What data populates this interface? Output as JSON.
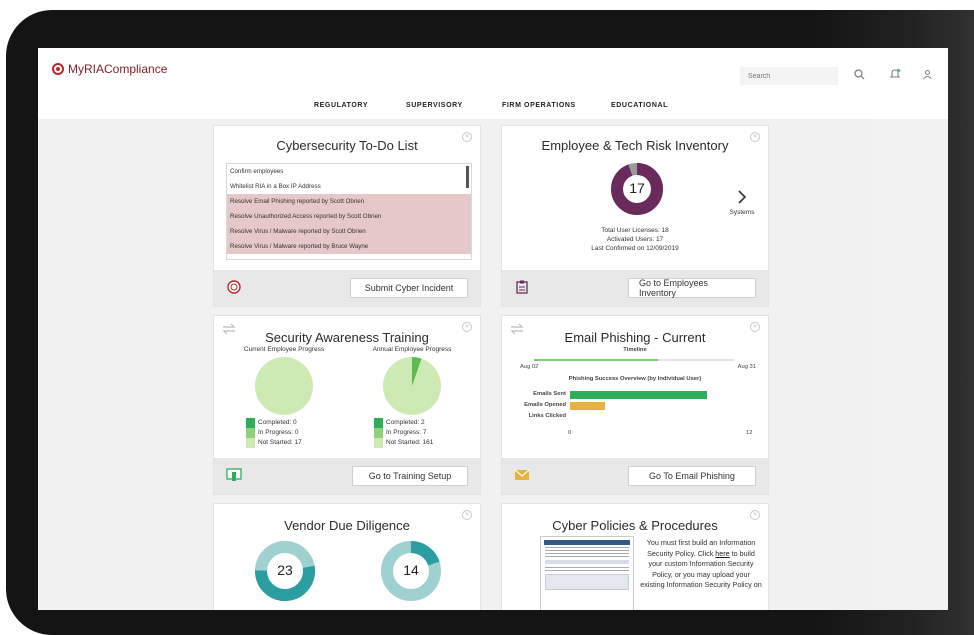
{
  "app": {
    "logo_text": "MyRIACompliance",
    "search_placeholder": "Search",
    "icons": [
      "search-icon",
      "bell-icon",
      "user-icon"
    ]
  },
  "nav": {
    "items": [
      "REGULATORY",
      "SUPERVISORY",
      "FIRM OPERATIONS",
      "EDUCATIONAL"
    ]
  },
  "todo_card": {
    "title": "Cybersecurity To-Do List",
    "items": [
      "Confirm employees",
      "Whitelist RIA in a Box IP Address",
      "Resolve Email Phishing reported by Scott Obrien",
      "Resolve Unauthorized Access reported by Scott Obrien",
      "Resolve Virus / Malware reported by Scott Obrien",
      "Resolve Virus / Malware reported by Bruce Wayne"
    ],
    "button": "Submit Cyber Incident",
    "icon": "shield-alert-icon"
  },
  "employee_card": {
    "title": "Employee & Tech Risk Inventory",
    "count": "17",
    "next_label": "Systems",
    "total_licenses": "Total User Licenses: 18",
    "activated_users": "Activated Users: 17",
    "last_confirmed": "Last Confirmed on 12/09/2019",
    "button": "Go to Employees Inventory",
    "icon": "clipboard-icon",
    "ring_fraction": 0.944
  },
  "training_card": {
    "title": "Security Awareness Training",
    "current_label": "Current Employee Progress",
    "annual_label": "Annual Employee Progress",
    "current_stats": [
      "Completed: 0",
      "In Progress: 0",
      "Not Started: 17"
    ],
    "annual_stats": [
      "Completed: 2",
      "In Progress: 7",
      "Not Started: 161"
    ],
    "annual_completed_fraction": 0.0529,
    "button": "Go to Training Setup",
    "icon": "certificate-icon"
  },
  "phishing_card": {
    "title": "Email Phishing - Current",
    "timeline_label": "Timeline",
    "date_start": "Aug 02",
    "date_end": "Aug 31",
    "overview_title": "Phishing Success Overview (by Individual User)",
    "bars": [
      {
        "label": "Emails Sent",
        "value": 9
      },
      {
        "label": "Emails Opened",
        "value": 2.3
      },
      {
        "label": "Links Clicked",
        "value": 0
      }
    ],
    "axis_min": "0",
    "axis_max": "12",
    "button": "Go To Email Phishing",
    "icon": "envelope-icon"
  },
  "vendor_card": {
    "title": "Vendor Due Diligence",
    "left_value": "23",
    "right_value": "14"
  },
  "policies_card": {
    "title": "Cyber Policies & Procedures",
    "text_before": "You must first build an Information Security Policy. Click",
    "link": "here",
    "text_after": "to build your custom Information Security Policy, or you may upload your existing Information Security Policy on"
  },
  "colors": {
    "accent": "#b3282e",
    "purple": "#6b2a5c",
    "green": "#2fae5a",
    "light_green": "#cdeab4",
    "teal": "#2a9ea0",
    "light_teal": "#9fd1d0",
    "orange": "#e8b23f",
    "alert_row": "#e6c8c8"
  }
}
